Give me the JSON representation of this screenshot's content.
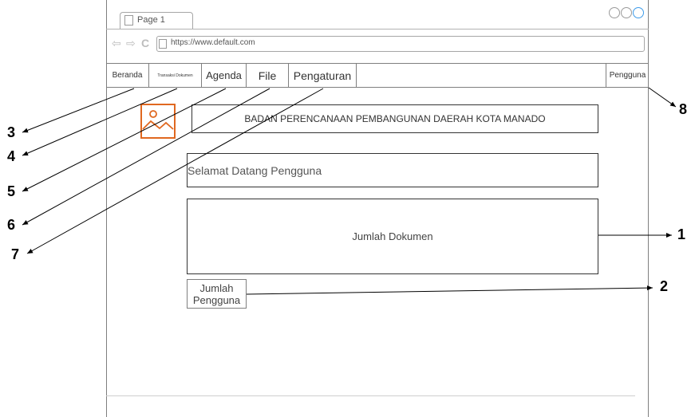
{
  "browser": {
    "tab_label": "Page 1",
    "url": "https://www.default.com"
  },
  "nav": {
    "beranda": "Beranda",
    "transaksi_dokumen": "Transaksi Dokumen",
    "agenda": "Agenda",
    "file": "File",
    "pengaturan": "Pengaturan",
    "pengguna": "Pengguna"
  },
  "content": {
    "header": "BADAN PERENCANAAN PEMBANGUNAN DAERAH KOTA MANADO",
    "welcome": "Selamat Datang Pengguna",
    "jumlah_dokumen": "Jumlah Dokumen",
    "jumlah_pengguna_line1": "Jumlah",
    "jumlah_pengguna_line2": "Pengguna"
  },
  "callouts": {
    "c1": "1",
    "c2": "2",
    "c3": "3",
    "c4": "4",
    "c5": "5",
    "c6": "6",
    "c7": "7",
    "c8": "8"
  },
  "colors": {
    "logo_accent": "#e06820",
    "window_button_active": "#3d9be9"
  },
  "icons": [
    "page-icon",
    "back-icon",
    "forward-icon",
    "reload-icon",
    "window-circle-icon",
    "image-placeholder-icon"
  ]
}
